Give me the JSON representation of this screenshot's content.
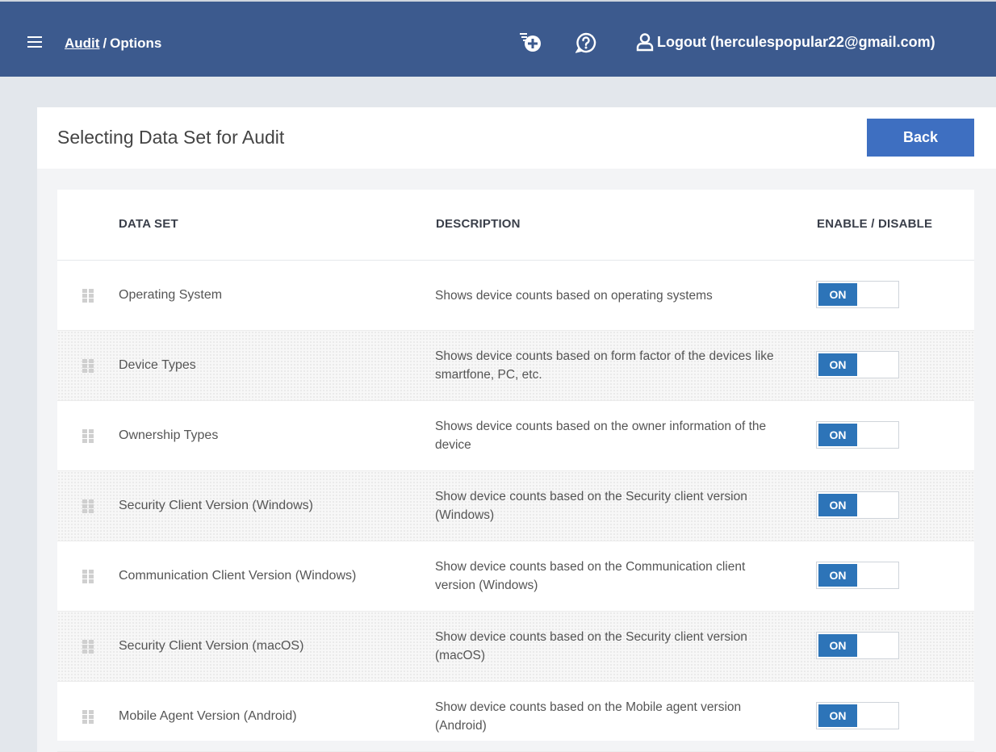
{
  "header": {
    "breadcrumb_link": "Audit",
    "breadcrumb_sep": "/",
    "breadcrumb_current": "Options",
    "logout_label": "Logout (herculespopular22@gmail.com)",
    "icons": [
      "menu-icon",
      "add-icon",
      "help-icon",
      "user-icon"
    ],
    "bar_color": "#3c5a8e"
  },
  "page": {
    "title": "Selecting Data Set for Audit",
    "back_label": "Back"
  },
  "table": {
    "columns": [
      "DATA SET",
      "DESCRIPTION",
      "ENABLE / DISABLE"
    ],
    "rows": [
      {
        "name": "Operating System",
        "description": "Shows device counts based on operating systems",
        "toggle": "ON"
      },
      {
        "name": "Device Types",
        "description": "Shows device counts based on form factor of the devices like smartfone, PC, etc.",
        "toggle": "ON"
      },
      {
        "name": "Ownership Types",
        "description": "Shows device counts based on the owner information of the device",
        "toggle": "ON"
      },
      {
        "name": "Security Client Version (Windows)",
        "description": "Show device counts based on the Security client version (Windows)",
        "toggle": "ON"
      },
      {
        "name": "Communication Client Version (Windows)",
        "description": "Show device counts based on the Communication client version (Windows)",
        "toggle": "ON"
      },
      {
        "name": "Security Client Version (macOS)",
        "description": "Show device counts based on the Security client version (macOS)",
        "toggle": "ON"
      },
      {
        "name": "Mobile Agent Version (Android)",
        "description": "Show device counts based on the Mobile agent version (Android)",
        "toggle": "ON"
      }
    ]
  },
  "colors": {
    "accent": "#3e6fc1",
    "toggle_on": "#2d74b8"
  }
}
